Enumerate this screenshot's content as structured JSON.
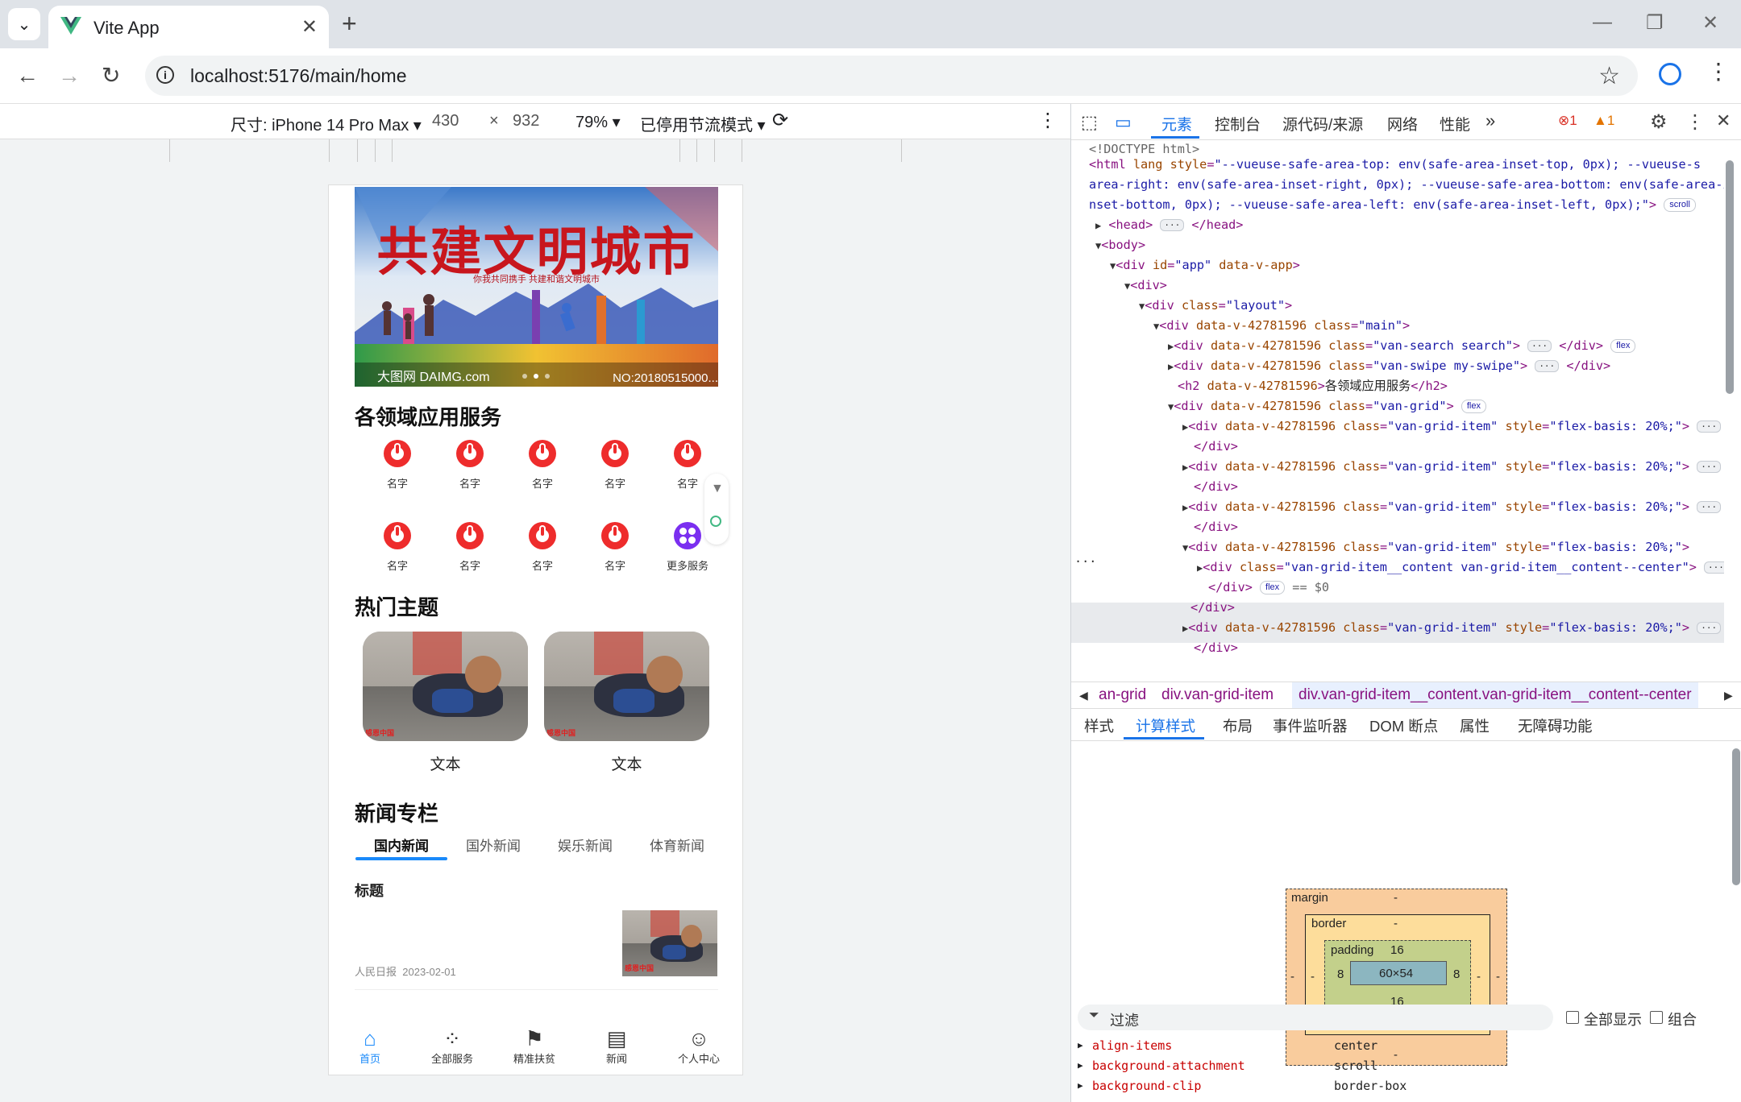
{
  "browser": {
    "tab_title": "Vite App",
    "url": "localhost:5176/main/home"
  },
  "device_toolbar": {
    "device_label": "尺寸: iPhone 14 Pro Max",
    "width": "430",
    "times": "×",
    "height": "932",
    "zoom": "79%",
    "throttle": "已停用节流模式"
  },
  "app": {
    "banner": {
      "title": "共建文明城市",
      "subtitle": "你我共同携手 共建和谐文明城市",
      "watermark": "大图网 DAIMG.com",
      "code": "NO:20180515000..."
    },
    "services_title": "各领域应用服务",
    "services": [
      {
        "label": "名字"
      },
      {
        "label": "名字"
      },
      {
        "label": "名字"
      },
      {
        "label": "名字"
      },
      {
        "label": "名字"
      },
      {
        "label": "名字"
      },
      {
        "label": "名字"
      },
      {
        "label": "名字"
      },
      {
        "label": "名字"
      },
      {
        "label": "更多服务"
      }
    ],
    "topics_title": "热门主题",
    "topics": [
      {
        "label": "文本"
      },
      {
        "label": "文本"
      }
    ],
    "photo_tag": "感恩中国",
    "news_title": "新闻专栏",
    "news_tabs": [
      "国内新闻",
      "国外新闻",
      "娱乐新闻",
      "体育新闻"
    ],
    "news_item": {
      "title": "标题",
      "source": "人民日报",
      "date": "2023-02-01"
    },
    "bottom_tabs": [
      {
        "label": "首页",
        "icon": "home-icon"
      },
      {
        "label": "全部服务",
        "icon": "apps-icon"
      },
      {
        "label": "精准扶贫",
        "icon": "flag-icon"
      },
      {
        "label": "新闻",
        "icon": "news-icon"
      },
      {
        "label": "个人中心",
        "icon": "user-icon"
      }
    ],
    "accent": "#1989fa"
  },
  "devtools": {
    "tabs": [
      "元素",
      "控制台",
      "源代码/来源",
      "网络",
      "性能"
    ],
    "errors": "1",
    "warnings": "1",
    "breadcrumbs": [
      "an-grid",
      "div.van-grid-item",
      "div.van-grid-item__content.van-grid-item__content--center"
    ],
    "subtabs": [
      "样式",
      "计算样式",
      "布局",
      "事件监听器",
      "DOM 断点",
      "属性",
      "无障碍功能"
    ],
    "box_model": {
      "margin_label": "margin",
      "margin": "-",
      "border_label": "border",
      "border": "-",
      "padding_label": "padding",
      "padding_top": "16",
      "padding_bottom": "16",
      "padding_left": "8",
      "padding_right": "8",
      "content": "60×54"
    },
    "filter_placeholder": "过滤",
    "show_all": "全部显示",
    "group": "组合",
    "computed": [
      {
        "name": "align-items",
        "value": "center"
      },
      {
        "name": "background-attachment",
        "value": "scroll"
      },
      {
        "name": "background-clip",
        "value": "border-box"
      }
    ]
  }
}
